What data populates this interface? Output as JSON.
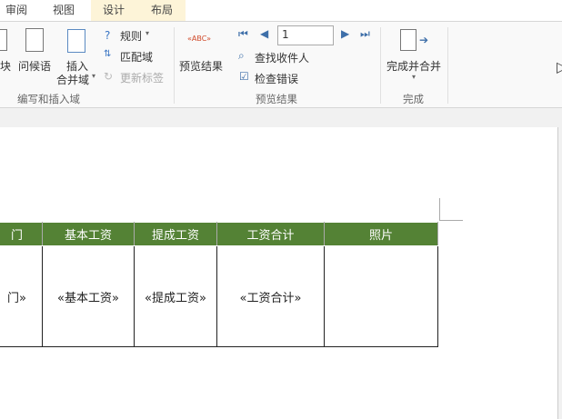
{
  "tabs": [
    "审阅",
    "视图",
    "设计",
    "布局"
  ],
  "ribbon": {
    "write_insert": {
      "block": "块",
      "greeting": "问候语",
      "insert_field_1": "插入",
      "insert_field_2": "合并域",
      "rules": "规则",
      "match_fields": "匹配域",
      "update_labels": "更新标签",
      "group": "编写和插入域"
    },
    "preview": {
      "preview_results": "预览结果",
      "record": "1",
      "find_recipient": "查找收件人",
      "check_errors": "检查错误",
      "group": "预览结果"
    },
    "finish": {
      "finish_merge": "完成并合并",
      "group": "完成"
    }
  },
  "table": {
    "headers": [
      "门",
      "基本工资",
      "提成工资",
      "工资合计",
      "照片"
    ],
    "cells": [
      "门»",
      "«基本工资»",
      "«提成工资»",
      "«工资合计»",
      ""
    ]
  },
  "colors": {
    "header_green": "#548235"
  }
}
